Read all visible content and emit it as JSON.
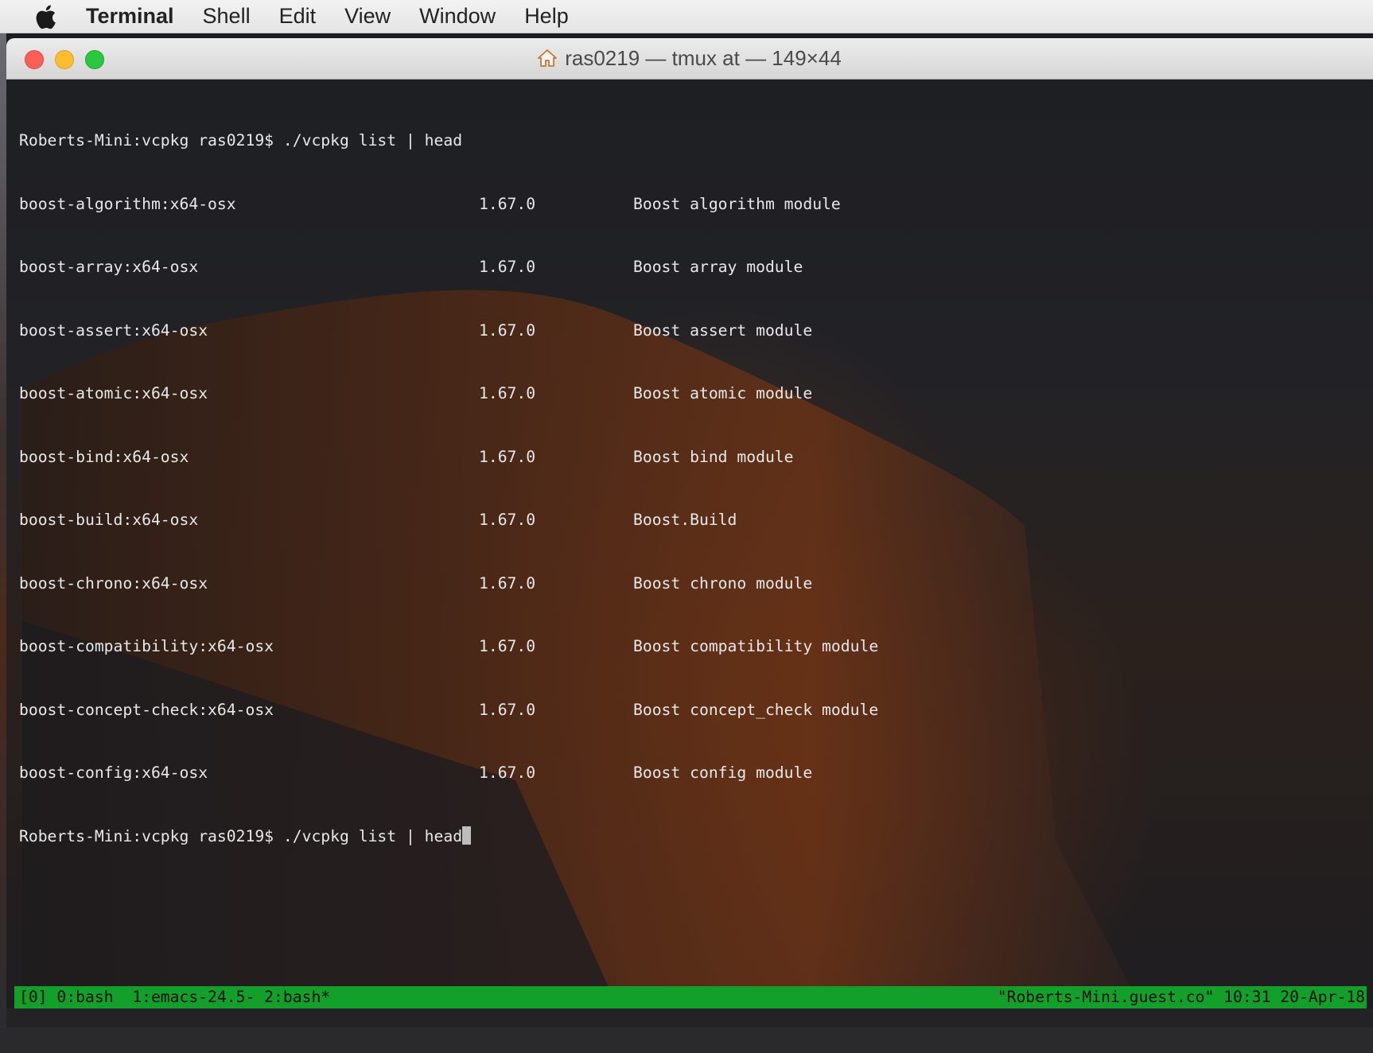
{
  "menubar": {
    "apple_icon": "apple-logo-icon",
    "items": [
      "Terminal",
      "Shell",
      "Edit",
      "View",
      "Window",
      "Help"
    ]
  },
  "window": {
    "title": "ras0219 — tmux at — 149×44",
    "title_icon": "home-icon"
  },
  "terminal": {
    "prompt": "Roberts-Mini:vcpkg ras0219$ ",
    "command": "./vcpkg list | head",
    "rows": [
      {
        "name": "boost-algorithm:x64-osx",
        "version": "1.67.0",
        "description": "Boost algorithm module"
      },
      {
        "name": "boost-array:x64-osx",
        "version": "1.67.0",
        "description": "Boost array module"
      },
      {
        "name": "boost-assert:x64-osx",
        "version": "1.67.0",
        "description": "Boost assert module"
      },
      {
        "name": "boost-atomic:x64-osx",
        "version": "1.67.0",
        "description": "Boost atomic module"
      },
      {
        "name": "boost-bind:x64-osx",
        "version": "1.67.0",
        "description": "Boost bind module"
      },
      {
        "name": "boost-build:x64-osx",
        "version": "1.67.0",
        "description": "Boost.Build"
      },
      {
        "name": "boost-chrono:x64-osx",
        "version": "1.67.0",
        "description": "Boost chrono module"
      },
      {
        "name": "boost-compatibility:x64-osx",
        "version": "1.67.0",
        "description": "Boost compatibility module"
      },
      {
        "name": "boost-concept-check:x64-osx",
        "version": "1.67.0",
        "description": "Boost concept_check module"
      },
      {
        "name": "boost-config:x64-osx",
        "version": "1.67.0",
        "description": "Boost config module"
      }
    ],
    "last_prompt": "Roberts-Mini:vcpkg ras0219$ ",
    "last_command": "./vcpkg list | head"
  },
  "tmux": {
    "status_left": "[0] 0:bash  1:emacs-24.5- 2:bash*",
    "status_right": "\"Roberts-Mini.guest.co\" 10:31 20-Apr-18",
    "color": "#13a02a"
  },
  "colors": {
    "close": "#fc5f57",
    "minimize": "#fdbd2e",
    "maximize": "#29c840",
    "terminal_text": "#e8e8e8"
  }
}
